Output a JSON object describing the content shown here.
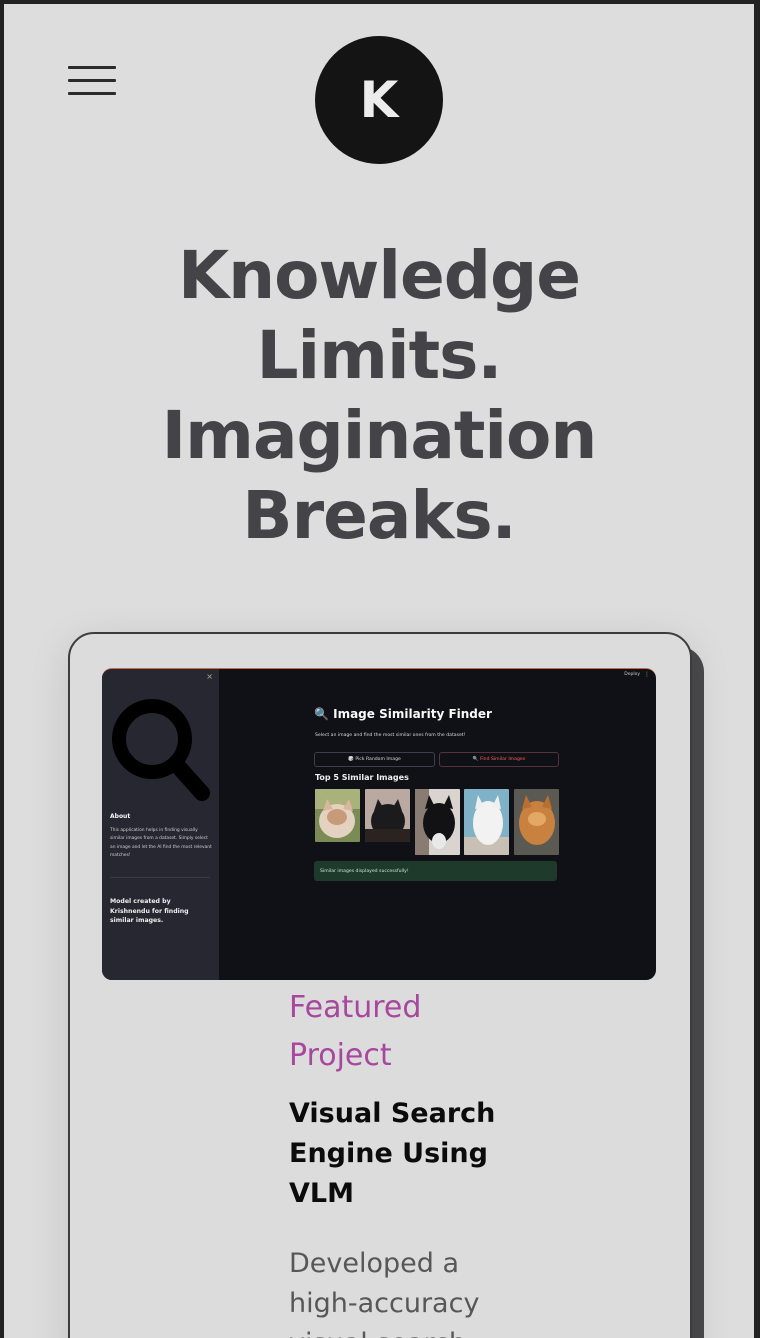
{
  "header": {
    "menu_icon": "hamburger-icon",
    "logo_letter": "K"
  },
  "hero": {
    "lines": [
      "Knowledge",
      "Limits.",
      "Imagination",
      "Breaks."
    ]
  },
  "project": {
    "eyebrow": "Featured Project",
    "title": "Visual Search Engine Using VLM",
    "description": "Developed a high-accuracy visual search",
    "screenshot": {
      "close_glyph": "×",
      "deploy_label": "Deploy",
      "menu_glyph": "⋮",
      "sidebar_icon": "magnifier-icon",
      "about_heading": "About",
      "about_text": "This application helps in finding visually similar images from a dataset. Simply select an image and let the AI find the most relevant matches!",
      "credit": "Model created by Krishnendu for finding similar images.",
      "app_title": "🔍 Image Similarity Finder",
      "app_subtitle": "Select an image and find the most similar ones from the dataset!",
      "pick_button": "🎲 Pick Random Image",
      "find_button": "🔍 Find Similar Images",
      "results_heading": "Top 5 Similar Images",
      "success_message": "Similar images displayed successfully!",
      "colors": {
        "sidebar": "#262730",
        "main": "#0f1117",
        "success": "#1e3a2a",
        "accent": "#ff5e5e"
      }
    }
  },
  "colors": {
    "page_bg": "#dddddd",
    "hero_text": "#444448",
    "eyebrow": "#a8479f"
  }
}
